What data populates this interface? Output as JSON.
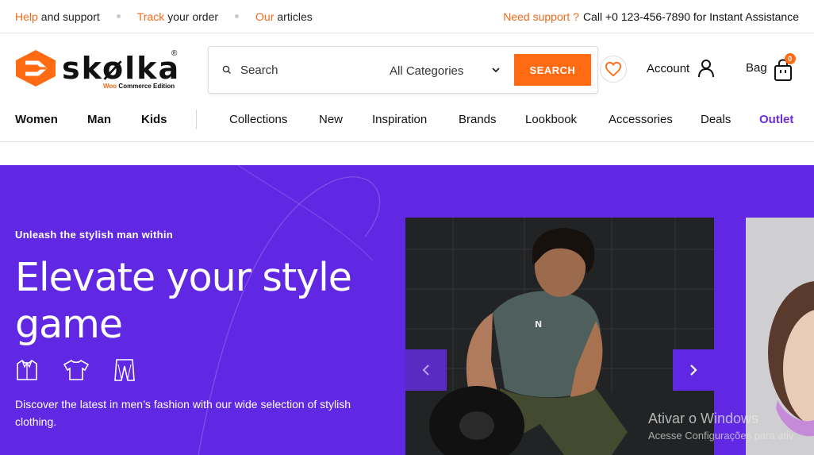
{
  "colors": {
    "accent": "#ff6a13",
    "brand_purple": "#6128e4",
    "outlet": "#6a2ee0"
  },
  "topbar": {
    "help_accent": "Help",
    "help_rest": "and support",
    "track_accent": "Track",
    "track_rest": "your order",
    "articles_accent": "Our",
    "articles_rest": "articles",
    "support_accent": "Need support ?",
    "support_rest": "Call +0 123-456-7890 for Instant Assistance"
  },
  "logo": {
    "word": "skølka",
    "reg": "®",
    "edition_woo": "Woo",
    "edition_rest": "Commerce Edition"
  },
  "search": {
    "placeholder": "Search",
    "category": "All Categories",
    "button": "SEARCH"
  },
  "header": {
    "account": "Account",
    "bag": "Bag",
    "bag_count": "0"
  },
  "nav": {
    "primary": [
      "Women",
      "Man",
      "Kids"
    ],
    "secondary": [
      "Collections",
      "New",
      "Inspiration",
      "Brands",
      "Lookbook",
      "Accessories",
      "Deals",
      "Outlet"
    ]
  },
  "hero": {
    "kicker": "Unleash the stylish man within",
    "headline": "Elevate your style game",
    "description": "Discover the latest in men’s fashion with our wide selection of stylish clothing.",
    "icons": [
      "shirt-icon",
      "tshirt-icon",
      "pants-icon"
    ]
  },
  "watermark": {
    "title": "Ativar o Windows",
    "subtitle": "Acesse Configurações para ativ"
  }
}
